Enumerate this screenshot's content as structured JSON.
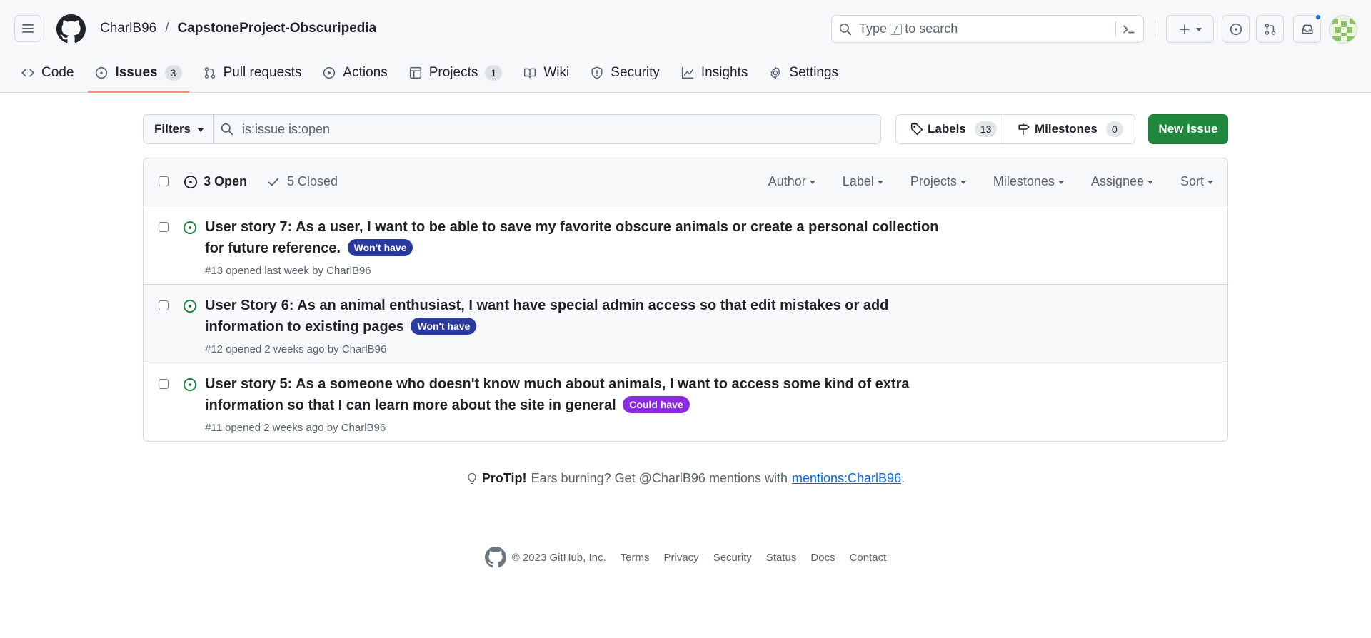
{
  "header": {
    "owner": "CharlB96",
    "separator": "/",
    "repo": "CapstoneProject-Obscuripedia",
    "search_prefix": "Type",
    "search_key": "/",
    "search_suffix": "to search"
  },
  "nav": {
    "tabs": [
      {
        "label": "Code",
        "icon": "code-icon"
      },
      {
        "label": "Issues",
        "icon": "issue-opened-icon",
        "count": "3"
      },
      {
        "label": "Pull requests",
        "icon": "git-pull-request-icon"
      },
      {
        "label": "Actions",
        "icon": "play-icon"
      },
      {
        "label": "Projects",
        "icon": "table-icon",
        "count": "1"
      },
      {
        "label": "Wiki",
        "icon": "book-icon"
      },
      {
        "label": "Security",
        "icon": "shield-icon"
      },
      {
        "label": "Insights",
        "icon": "graph-icon"
      },
      {
        "label": "Settings",
        "icon": "gear-icon"
      }
    ],
    "selected": "Issues"
  },
  "toolbar": {
    "filters_label": "Filters",
    "search_value": "is:issue is:open",
    "labels_label": "Labels",
    "labels_count": "13",
    "milestones_label": "Milestones",
    "milestones_count": "0",
    "new_issue_label": "New issue"
  },
  "list_header": {
    "open_label": "3 Open",
    "closed_label": "5 Closed",
    "filters": [
      "Author",
      "Label",
      "Projects",
      "Milestones",
      "Assignee",
      "Sort"
    ]
  },
  "issues": [
    {
      "title": "User story 7: As a user, I want to be able to save my favorite obscure animals or create a personal collection for future reference.",
      "label": "Won't have",
      "label_color": "#2b3a9e",
      "meta": "#13 opened last week by CharlB96"
    },
    {
      "title": "User Story 6: As an animal enthusiast, I want have special admin access so that edit mistakes or add information to existing pages",
      "label": "Won't have",
      "label_color": "#2b3a9e",
      "meta": "#12 opened 2 weeks ago by CharlB96"
    },
    {
      "title": "User story 5: As a someone who doesn't know much about animals, I want to access some kind of extra information so that I can learn more about the site in general",
      "label": "Could have",
      "label_color": "#8a2be2",
      "meta": "#11 opened 2 weeks ago by CharlB96"
    }
  ],
  "protip": {
    "bold": "ProTip!",
    "text": "Ears burning? Get @CharlB96 mentions with",
    "link": "mentions:CharlB96",
    "end": "."
  },
  "footer": {
    "copyright": "© 2023 GitHub, Inc.",
    "links": [
      "Terms",
      "Privacy",
      "Security",
      "Status",
      "Docs",
      "Contact"
    ]
  },
  "colors": {
    "accent_green": "#1f883d",
    "open_icon": "#1a7f37",
    "selected_underline": "#fd8c73",
    "link": "#0969da"
  }
}
